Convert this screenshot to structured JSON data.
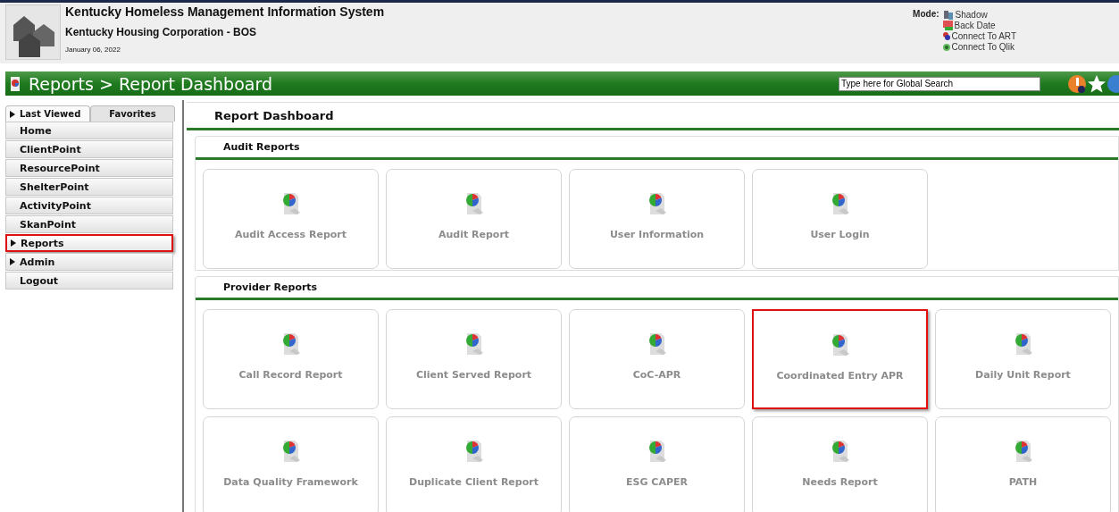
{
  "header": {
    "title": "Kentucky Homeless Management Information System",
    "organization": "Kentucky Housing Corporation - BOS",
    "date": "January 06, 2022",
    "mode_label": "Mode:",
    "modes": [
      {
        "kind": "shadow",
        "label": "Shadow"
      },
      {
        "kind": "backdate",
        "label": "Back Date"
      },
      {
        "kind": "art",
        "label": "Connect To ART"
      },
      {
        "kind": "qlik",
        "label": "Connect To Qlik"
      }
    ]
  },
  "breadcrumb_bar": {
    "title": "Reports > Report Dashboard",
    "search": {
      "placeholder": "Type here for Global Search"
    }
  },
  "sidebar": {
    "tabs": [
      {
        "label": "Last Viewed",
        "selected": true
      },
      {
        "label": "Favorites",
        "selected": false
      }
    ],
    "items": [
      {
        "label": "Home",
        "expandable": false,
        "highlighted": false
      },
      {
        "label": "ClientPoint",
        "expandable": false,
        "highlighted": false
      },
      {
        "label": "ResourcePoint",
        "expandable": false,
        "highlighted": false
      },
      {
        "label": "ShelterPoint",
        "expandable": false,
        "highlighted": false
      },
      {
        "label": "ActivityPoint",
        "expandable": false,
        "highlighted": false
      },
      {
        "label": "SkanPoint",
        "expandable": false,
        "highlighted": false
      },
      {
        "label": "Reports",
        "expandable": true,
        "highlighted": true
      },
      {
        "label": "Admin",
        "expandable": true,
        "highlighted": false
      },
      {
        "label": "Logout",
        "expandable": false,
        "highlighted": false
      }
    ]
  },
  "main": {
    "title": "Report Dashboard",
    "sections": [
      {
        "title": "Audit Reports",
        "tiles": [
          {
            "label": "Audit Access Report",
            "highlighted": false
          },
          {
            "label": "Audit Report",
            "highlighted": false
          },
          {
            "label": "User Information",
            "highlighted": false
          },
          {
            "label": "User Login",
            "highlighted": false
          }
        ]
      },
      {
        "title": "Provider Reports",
        "tiles": [
          {
            "label": "Call Record Report",
            "highlighted": false
          },
          {
            "label": "Client Served Report",
            "highlighted": false
          },
          {
            "label": "CoC-APR",
            "highlighted": false
          },
          {
            "label": "Coordinated Entry APR",
            "highlighted": true
          },
          {
            "label": "Daily Unit Report",
            "highlighted": false
          },
          {
            "label": "Data Quality Framework",
            "highlighted": false
          },
          {
            "label": "Duplicate Client Report",
            "highlighted": false
          },
          {
            "label": "ESG CAPER",
            "highlighted": false
          },
          {
            "label": "Needs Report",
            "highlighted": false
          },
          {
            "label": "PATH",
            "highlighted": false
          }
        ]
      }
    ]
  }
}
